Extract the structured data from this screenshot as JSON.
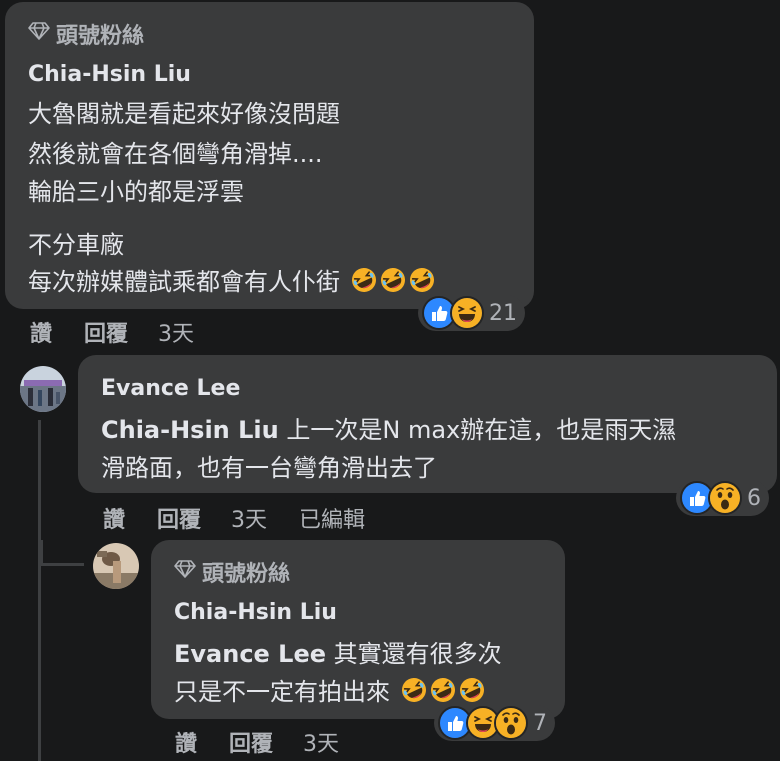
{
  "comments": [
    {
      "badge": "頭號粉絲",
      "author": "Chia-Hsin Liu",
      "lines": [
        "大魯閣就是看起來好像沒問題",
        "然後就會在各個彎角滑掉....",
        "輪胎三小的都是浮雲",
        "不分車廠",
        "每次辦媒體試乘都會有人仆街"
      ],
      "reaction_count": "21",
      "actions": {
        "like": "讚",
        "reply": "回覆",
        "time": "3天"
      }
    },
    {
      "author": "Evance Lee",
      "tag": "Chia-Hsin Liu",
      "lines": [
        " 上一次是N max辦在這，也是雨天濕",
        "滑路面，也有一台彎角滑出去了"
      ],
      "reaction_count": "6",
      "actions": {
        "like": "讚",
        "reply": "回覆",
        "time": "3天",
        "edited": "已編輯"
      }
    },
    {
      "badge": "頭號粉絲",
      "author": "Chia-Hsin Liu",
      "tag": "Evance Lee",
      "lines": [
        " 其實還有很多次",
        "只是不一定有拍出來"
      ],
      "reaction_count": "7",
      "actions": {
        "like": "讚",
        "reply": "回覆",
        "time": "3天"
      }
    }
  ],
  "icons": {
    "badge": "diamond-icon",
    "reactions": [
      "like-icon",
      "haha-icon",
      "wow-icon"
    ],
    "inline_emoji": "rolling-on-floor-laughing-emoji"
  },
  "colors": {
    "like": "#2d88ff",
    "emoji": "#f7b125",
    "bubble": "#3a3b3c",
    "background": "#18191a"
  }
}
